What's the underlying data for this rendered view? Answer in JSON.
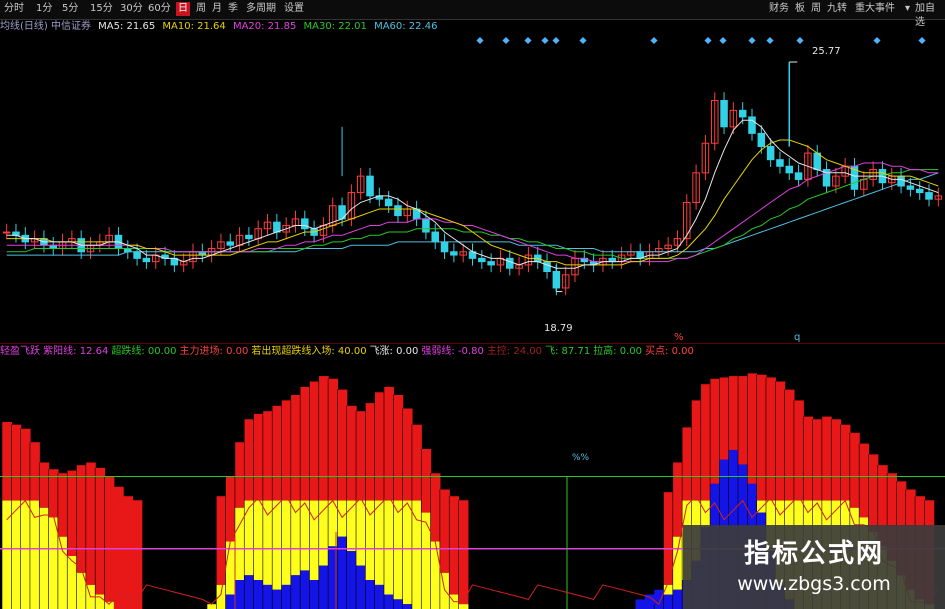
{
  "toolbar": {
    "periods": [
      "分时",
      "1分",
      "5分",
      "15分",
      "30分",
      "60分",
      "日",
      "周",
      "月",
      "季",
      "多周期",
      "设置"
    ],
    "active_period": "日",
    "right_buttons": [
      "财务",
      "板",
      "周",
      "九转",
      "重大事件",
      "▾",
      "加自选"
    ]
  },
  "ma_legend": {
    "stock_label": "均线(日线) 中信证券",
    "ma5": "MA5: 21.65",
    "ma10": "MA10: 21.64",
    "ma20": "MA20: 21.85",
    "ma30": "MA30: 22.01",
    "ma60": "MA60: 22.46",
    "colors": {
      "stock_label": "#9fa0c8",
      "ma5": "#e6e6e6",
      "ma10": "#e6d200",
      "ma20": "#e040e0",
      "ma30": "#28c828",
      "ma60": "#4fc0e0"
    }
  },
  "price_chart": {
    "high_label": "25.77",
    "low_label": "18.79",
    "marker_mid": "%",
    "marker_q": "q"
  },
  "indicator_legend": {
    "items": [
      {
        "text": "轻盈飞跃 紫阳线: 12.64",
        "color": "#e040e0"
      },
      {
        "text": "超跌线: 00.00",
        "color": "#28c828"
      },
      {
        "text": "主力进场: 0.00",
        "color": "#ff4040"
      },
      {
        "text": "若出现超跌线入场: 40.00",
        "color": "#e6d200"
      },
      {
        "text": "飞涨: 0.00",
        "color": "#e6e6e6"
      },
      {
        "text": "强弱线: -0.80",
        "color": "#e040e0"
      },
      {
        "text": "主控: 24.00",
        "color": "#a02020"
      },
      {
        "text": "飞: 87.71",
        "color": "#28c828"
      },
      {
        "text": "拉高: 0.00",
        "color": "#28c828"
      },
      {
        "text": "买点: 0.00",
        "color": "#ff4040"
      }
    ]
  },
  "indicator_chart": {
    "center_label": "%%"
  },
  "watermark": {
    "title": "指标公式网",
    "url": "www.zbgs3.com"
  },
  "chart_data": {
    "type": "candlestick",
    "title": "中信证券",
    "price_ylim": [
      17.5,
      26.5
    ],
    "price_high": 25.77,
    "price_low": 18.79,
    "close": [
      20.6,
      20.5,
      20.3,
      20.4,
      20.2,
      20.1,
      20.3,
      20.4,
      20.0,
      20.2,
      20.3,
      20.5,
      20.1,
      20.0,
      19.8,
      19.7,
      19.9,
      19.8,
      19.6,
      19.7,
      20.0,
      19.9,
      20.1,
      20.3,
      20.2,
      20.5,
      20.4,
      20.7,
      20.9,
      20.6,
      20.8,
      21.0,
      20.7,
      20.5,
      20.8,
      21.4,
      21.0,
      21.8,
      22.3,
      21.7,
      21.6,
      21.4,
      21.1,
      21.3,
      21.0,
      20.6,
      20.3,
      20.0,
      19.9,
      20.0,
      19.8,
      19.7,
      19.6,
      19.8,
      19.5,
      19.6,
      19.9,
      19.7,
      19.4,
      18.9,
      19.3,
      19.8,
      19.7,
      19.6,
      19.8,
      19.7,
      19.9,
      20.0,
      19.8,
      20.0,
      20.1,
      20.2,
      20.4,
      21.5,
      22.4,
      23.3,
      24.6,
      23.8,
      24.3,
      24.1,
      23.6,
      23.2,
      22.8,
      22.6,
      22.4,
      22.2,
      23.0,
      22.5,
      22.0,
      22.3,
      22.6,
      21.9,
      22.2,
      22.5,
      22.1,
      22.3,
      22.0,
      21.9,
      21.8,
      21.6,
      21.7
    ],
    "ma5": [
      20.5,
      20.5,
      20.4,
      20.4,
      20.3,
      20.3,
      20.3,
      20.3,
      20.2,
      20.2,
      20.2,
      20.3,
      20.3,
      20.2,
      20.1,
      19.9,
      19.9,
      19.8,
      19.8,
      19.7,
      19.8,
      19.8,
      19.9,
      20.0,
      20.1,
      20.2,
      20.3,
      20.4,
      20.5,
      20.6,
      20.7,
      20.8,
      20.8,
      20.7,
      20.8,
      20.9,
      21.0,
      21.3,
      21.5,
      21.6,
      21.7,
      21.7,
      21.6,
      21.4,
      21.3,
      21.1,
      20.9,
      20.6,
      20.4,
      20.2,
      20.0,
      19.9,
      19.8,
      19.8,
      19.7,
      19.6,
      19.7,
      19.7,
      19.6,
      19.5,
      19.5,
      19.5,
      19.6,
      19.6,
      19.7,
      19.7,
      19.7,
      19.8,
      19.8,
      19.9,
      19.9,
      20.0,
      20.1,
      20.5,
      21.0,
      21.6,
      22.4,
      23.1,
      23.7,
      24.0,
      24.0,
      23.8,
      23.4,
      23.1,
      22.9,
      22.7,
      22.6,
      22.5,
      22.4,
      22.4,
      22.4,
      22.3,
      22.3,
      22.3,
      22.3,
      22.2,
      22.2,
      22.1,
      22.0,
      21.9,
      21.8
    ],
    "ma10": [
      20.4,
      20.4,
      20.4,
      20.4,
      20.4,
      20.3,
      20.3,
      20.3,
      20.3,
      20.3,
      20.3,
      20.3,
      20.3,
      20.2,
      20.2,
      20.1,
      20.1,
      20.0,
      19.9,
      19.9,
      19.9,
      19.9,
      19.9,
      19.9,
      19.9,
      20.0,
      20.1,
      20.2,
      20.3,
      20.3,
      20.4,
      20.5,
      20.6,
      20.6,
      20.7,
      20.8,
      20.9,
      21.0,
      21.1,
      21.2,
      21.3,
      21.3,
      21.3,
      21.3,
      21.3,
      21.2,
      21.1,
      21.0,
      20.9,
      20.8,
      20.6,
      20.4,
      20.2,
      20.1,
      20.0,
      19.9,
      19.8,
      19.8,
      19.7,
      19.7,
      19.6,
      19.6,
      19.6,
      19.6,
      19.6,
      19.6,
      19.6,
      19.7,
      19.7,
      19.8,
      19.8,
      19.8,
      19.9,
      20.1,
      20.4,
      20.7,
      21.1,
      21.6,
      22.0,
      22.4,
      22.8,
      23.1,
      23.3,
      23.4,
      23.4,
      23.3,
      23.2,
      23.0,
      22.8,
      22.7,
      22.6,
      22.5,
      22.4,
      22.4,
      22.4,
      22.3,
      22.3,
      22.3,
      22.2,
      22.1,
      22.0
    ],
    "ma20": [
      20.2,
      20.2,
      20.2,
      20.2,
      20.2,
      20.2,
      20.2,
      20.2,
      20.2,
      20.2,
      20.2,
      20.2,
      20.2,
      20.2,
      20.2,
      20.1,
      20.1,
      20.1,
      20.0,
      20.0,
      20.0,
      20.0,
      20.0,
      20.0,
      20.0,
      20.0,
      20.0,
      20.1,
      20.1,
      20.1,
      20.2,
      20.2,
      20.3,
      20.3,
      20.4,
      20.5,
      20.5,
      20.6,
      20.7,
      20.8,
      20.8,
      20.9,
      20.9,
      20.9,
      21.0,
      21.0,
      21.0,
      20.9,
      20.9,
      20.8,
      20.8,
      20.7,
      20.6,
      20.5,
      20.4,
      20.3,
      20.2,
      20.1,
      20.0,
      19.9,
      19.9,
      19.8,
      19.8,
      19.7,
      19.7,
      19.7,
      19.7,
      19.7,
      19.7,
      19.7,
      19.7,
      19.7,
      19.8,
      19.8,
      19.9,
      20.1,
      20.3,
      20.5,
      20.7,
      20.9,
      21.1,
      21.3,
      21.5,
      21.7,
      21.9,
      22.0,
      22.2,
      22.3,
      22.4,
      22.5,
      22.6,
      22.6,
      22.7,
      22.7,
      22.7,
      22.6,
      22.6,
      22.5,
      22.5,
      22.4,
      22.4
    ],
    "ma30": [
      20.0,
      20.0,
      20.0,
      20.1,
      20.1,
      20.1,
      20.1,
      20.1,
      20.1,
      20.1,
      20.1,
      20.1,
      20.1,
      20.1,
      20.1,
      20.1,
      20.1,
      20.0,
      20.0,
      20.0,
      20.0,
      20.0,
      20.0,
      20.0,
      20.0,
      20.0,
      20.0,
      20.0,
      20.0,
      20.1,
      20.1,
      20.1,
      20.1,
      20.2,
      20.2,
      20.3,
      20.3,
      20.4,
      20.4,
      20.5,
      20.5,
      20.6,
      20.6,
      20.6,
      20.7,
      20.7,
      20.7,
      20.7,
      20.7,
      20.6,
      20.6,
      20.6,
      20.5,
      20.5,
      20.4,
      20.4,
      20.3,
      20.3,
      20.2,
      20.1,
      20.1,
      20.0,
      20.0,
      19.9,
      19.9,
      19.9,
      19.8,
      19.8,
      19.8,
      19.8,
      19.8,
      19.8,
      19.8,
      19.8,
      19.9,
      20.0,
      20.1,
      20.2,
      20.4,
      20.5,
      20.7,
      20.8,
      21.0,
      21.1,
      21.3,
      21.4,
      21.6,
      21.7,
      21.8,
      21.9,
      22.0,
      22.1,
      22.2,
      22.3,
      22.3,
      22.4,
      22.4,
      22.5,
      22.5,
      22.5,
      22.5
    ],
    "ma60": [
      19.9,
      19.9,
      19.9,
      19.9,
      19.9,
      19.9,
      19.9,
      19.9,
      19.9,
      19.9,
      19.9,
      19.9,
      19.9,
      20.0,
      20.0,
      20.0,
      20.0,
      20.0,
      20.0,
      20.0,
      20.0,
      20.0,
      20.0,
      20.0,
      20.0,
      20.0,
      20.0,
      20.0,
      20.0,
      20.0,
      20.0,
      20.0,
      20.1,
      20.1,
      20.1,
      20.1,
      20.1,
      20.2,
      20.2,
      20.2,
      20.2,
      20.2,
      20.3,
      20.3,
      20.3,
      20.3,
      20.3,
      20.3,
      20.3,
      20.3,
      20.3,
      20.3,
      20.3,
      20.3,
      20.3,
      20.2,
      20.2,
      20.2,
      20.2,
      20.2,
      20.1,
      20.1,
      20.1,
      20.1,
      20.0,
      20.0,
      20.0,
      20.0,
      20.0,
      20.0,
      20.0,
      20.0,
      20.0,
      20.0,
      20.0,
      20.1,
      20.1,
      20.2,
      20.3,
      20.4,
      20.5,
      20.6,
      20.7,
      20.8,
      20.9,
      21.0,
      21.1,
      21.2,
      21.3,
      21.4,
      21.5,
      21.6,
      21.7,
      21.8,
      21.9,
      22.0,
      22.1,
      22.2,
      22.2,
      22.3,
      22.4
    ],
    "indicator": {
      "ylim": [
        0,
        100
      ],
      "red_top": [
        60,
        58,
        55,
        45,
        30,
        25,
        22,
        24,
        28,
        30,
        26,
        20,
        12,
        5,
        2,
        0,
        0,
        0,
        0,
        0,
        0,
        0,
        0,
        5,
        20,
        45,
        62,
        66,
        68,
        72,
        76,
        80,
        86,
        90,
        94,
        92,
        84,
        72,
        68,
        74,
        82,
        86,
        80,
        70,
        58,
        40,
        22,
        10,
        5,
        2,
        0,
        0,
        0,
        0,
        0,
        0,
        0,
        0,
        0,
        0,
        0,
        0,
        0,
        0,
        0,
        0,
        0,
        0,
        0,
        0,
        0,
        8,
        30,
        56,
        76,
        88,
        92,
        93,
        94,
        94,
        96,
        95,
        93,
        90,
        84,
        76,
        64,
        62,
        64,
        62,
        58,
        52,
        44,
        36,
        28,
        22,
        16,
        10,
        5,
        2,
        0
      ],
      "yellow_top": [
        45,
        45,
        45,
        45,
        42,
        38,
        30,
        22,
        15,
        10,
        6,
        3,
        0,
        0,
        0,
        0,
        0,
        0,
        0,
        0,
        0,
        0,
        2,
        10,
        28,
        42,
        45,
        45,
        45,
        45,
        45,
        45,
        45,
        45,
        45,
        45,
        45,
        45,
        45,
        45,
        45,
        45,
        45,
        45,
        45,
        40,
        28,
        15,
        6,
        2,
        0,
        0,
        0,
        0,
        0,
        0,
        0,
        0,
        0,
        0,
        0,
        0,
        0,
        0,
        0,
        0,
        0,
        0,
        0,
        0,
        2,
        10,
        30,
        45,
        45,
        45,
        45,
        45,
        45,
        45,
        45,
        45,
        45,
        45,
        45,
        45,
        45,
        45,
        45,
        45,
        45,
        42,
        38,
        32,
        26,
        20,
        14,
        8,
        4,
        2,
        0
      ],
      "blue_top": [
        0,
        0,
        0,
        0,
        0,
        0,
        0,
        0,
        0,
        0,
        0,
        0,
        0,
        0,
        0,
        0,
        0,
        0,
        0,
        0,
        0,
        0,
        0,
        0,
        6,
        12,
        14,
        12,
        10,
        8,
        10,
        14,
        16,
        12,
        18,
        26,
        30,
        24,
        18,
        12,
        10,
        6,
        4,
        2,
        0,
        0,
        0,
        0,
        0,
        0,
        0,
        0,
        0,
        0,
        0,
        0,
        0,
        0,
        0,
        0,
        0,
        0,
        0,
        0,
        0,
        0,
        0,
        0,
        4,
        6,
        8,
        6,
        8,
        12,
        20,
        34,
        52,
        62,
        66,
        60,
        52,
        40,
        24,
        10,
        4,
        0,
        0,
        0,
        0,
        0,
        0,
        0,
        0,
        0,
        0,
        0,
        0,
        0,
        0,
        0,
        0
      ],
      "green_line": 55,
      "magenta_line": 25
    }
  }
}
